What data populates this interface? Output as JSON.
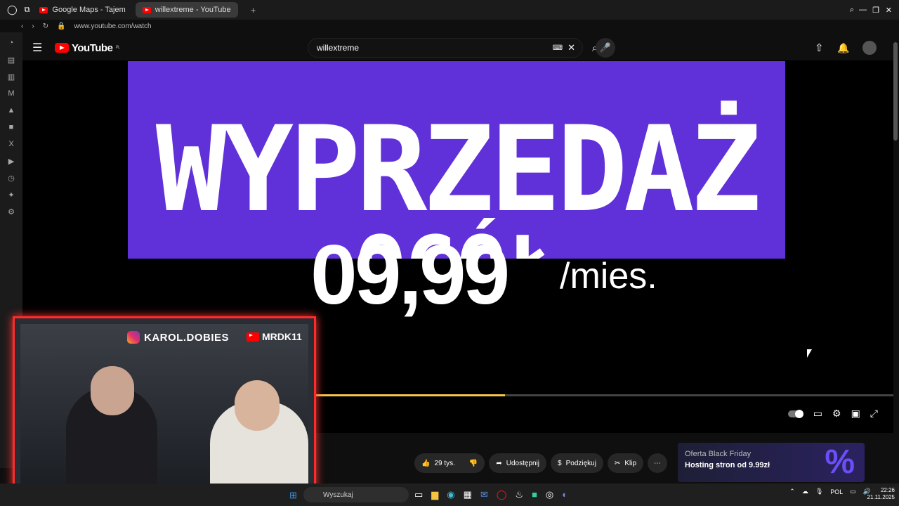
{
  "browser": {
    "tabs": [
      {
        "label": "Google Maps - Tajem"
      },
      {
        "label": "willextreme - YouTube"
      }
    ],
    "url": "www.youtube.com/watch"
  },
  "youtube": {
    "logo": "YouTube",
    "region": "PL",
    "search_value": "willextreme"
  },
  "video": {
    "banner_line1": "WYPRZEDAŻ",
    "banner_line2": "OGÓŁ",
    "price": "09,99",
    "per_month": "/mies.",
    "progress": 0.33
  },
  "overlay": {
    "instagram": "KAROL.DOBIES",
    "youtube": "MRDK11"
  },
  "actions": {
    "likes": "29 tys.",
    "share": "Udostępnij",
    "thanks": "Podziękuj",
    "clip": "Klip"
  },
  "ad": {
    "title": "Oferta Black Friday",
    "subtitle": "Hosting stron od 9.99zł",
    "symbol": "%"
  },
  "taskbar": {
    "search": "Wyszukaj",
    "lang": "POL",
    "time": "22:26",
    "date": "21.11.2025"
  }
}
